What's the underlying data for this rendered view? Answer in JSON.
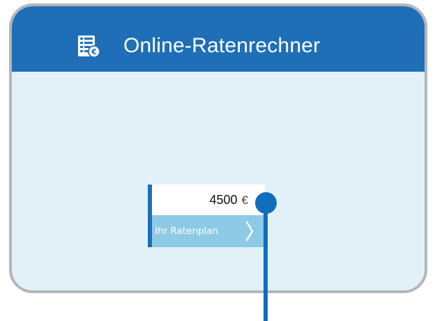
{
  "header": {
    "title": "Online-Ratenrechner",
    "icon": "calculator-euro-icon"
  },
  "calculator": {
    "amount": "4500",
    "currency": "€",
    "plan_button_label": "Ihr Ratenplan",
    "plan_button_icon": "chevron-right-icon"
  },
  "colors": {
    "header_background": "#1f6fb8",
    "card_background": "#e2f1f7",
    "card_border": "#b3b6b8",
    "accent_bar": "#1f6fb8",
    "button_background": "#8ccae6",
    "pointer": "#0f6fbb"
  }
}
